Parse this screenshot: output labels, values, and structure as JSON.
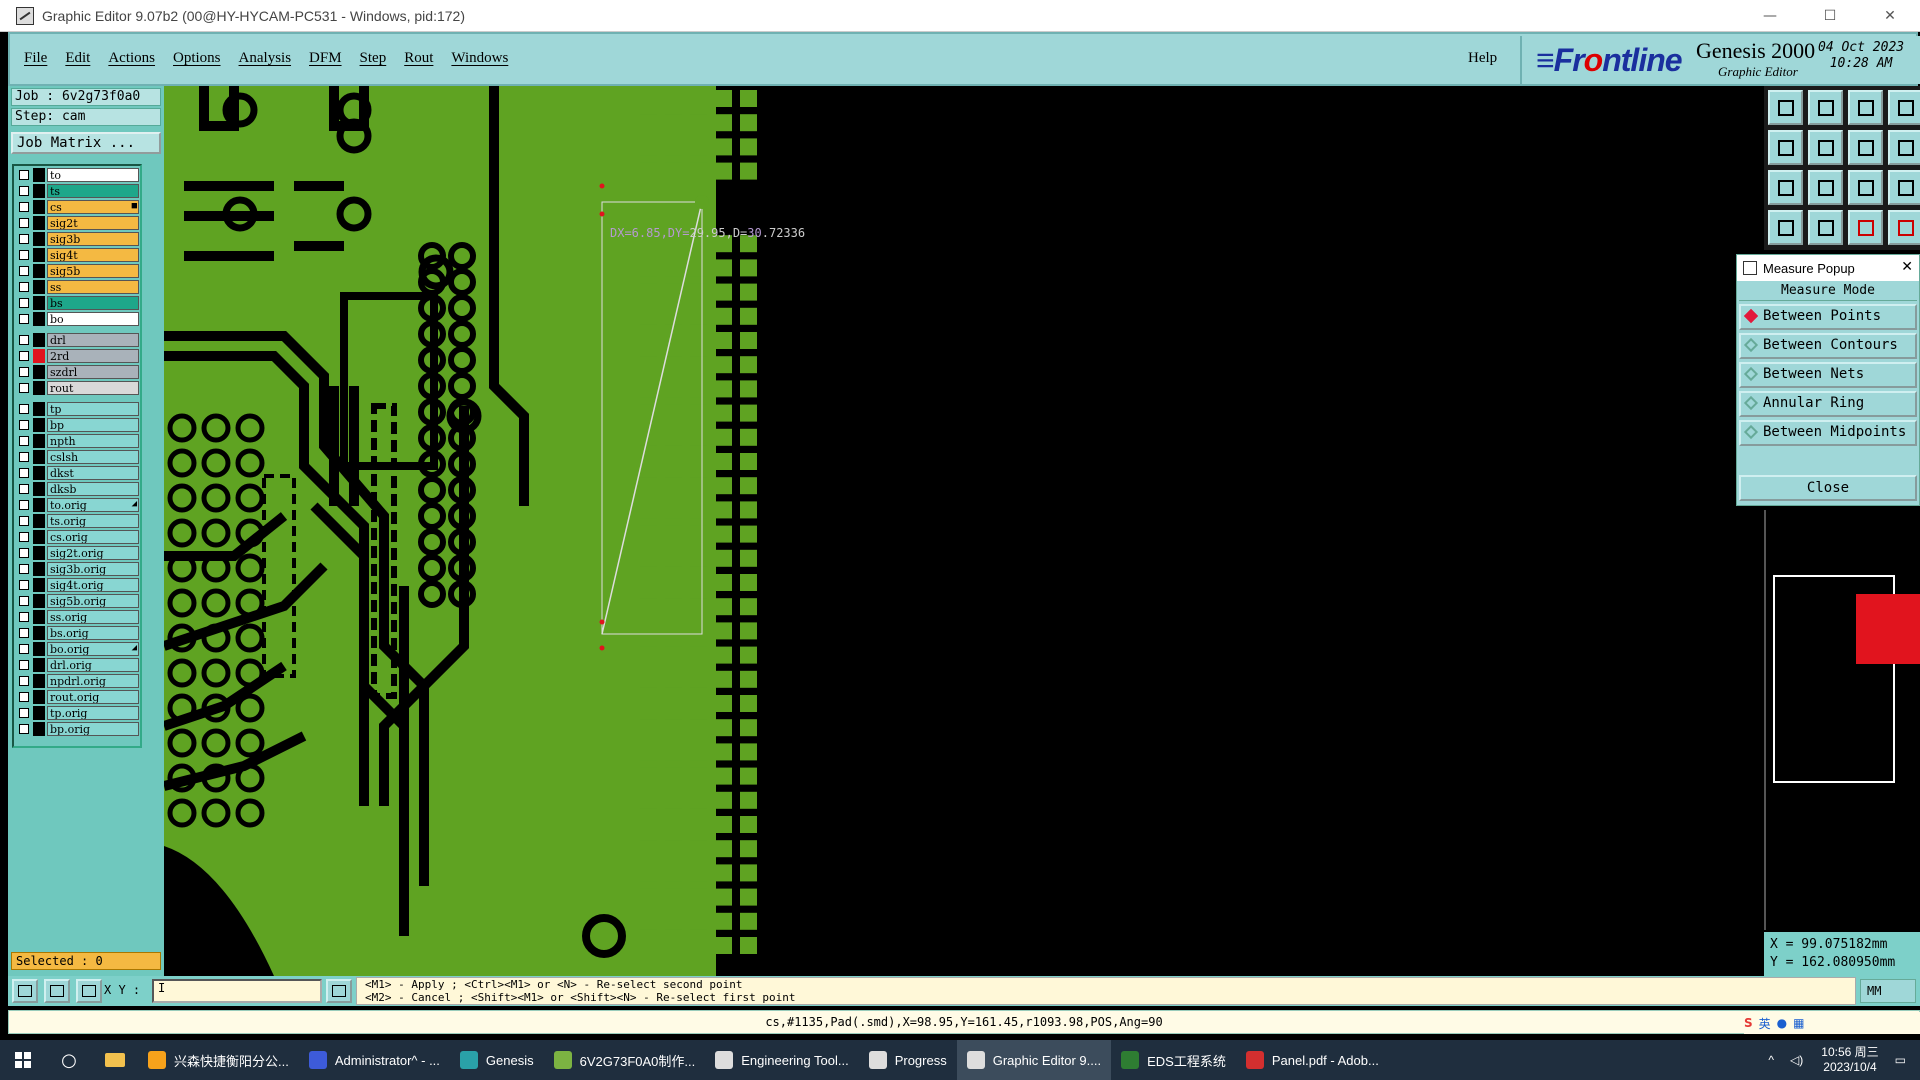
{
  "window": {
    "title": "Graphic Editor 9.07b2 (00@HY-HYCAM-PC531 - Windows, pid:172)",
    "controls": [
      "—",
      "☐",
      "✕"
    ]
  },
  "menu": [
    "File",
    "Edit",
    "Actions",
    "Options",
    "Analysis",
    "DFM",
    "Step",
    "Rout",
    "Windows"
  ],
  "help_label": "Help",
  "brand": {
    "logo_prefix": "≡Fr",
    "logo_o": "o",
    "logo_suffix": "ntline",
    "product": "Genesis 2000",
    "subtitle": "Graphic Editor",
    "date": "04 Oct 2023",
    "time": "10:28 AM"
  },
  "job": {
    "job_line": "Job : 6v2g73f0a0",
    "step_line": "Step: cam",
    "matrix_label": "Job Matrix ..."
  },
  "layers": [
    {
      "name": "to",
      "color": "#ffffff",
      "swatch": "#000000",
      "group": 0
    },
    {
      "name": "ts",
      "color": "#1ea78a",
      "swatch": "#000000",
      "group": 0
    },
    {
      "name": "cs",
      "color": "#f4b942",
      "swatch": "#000000",
      "group": 0,
      "mark": "■"
    },
    {
      "name": "sig2t",
      "color": "#f4b942",
      "swatch": "#000000",
      "group": 0
    },
    {
      "name": "sig3b",
      "color": "#f4b942",
      "swatch": "#000000",
      "group": 0
    },
    {
      "name": "sig4t",
      "color": "#f4b942",
      "swatch": "#000000",
      "group": 0
    },
    {
      "name": "sig5b",
      "color": "#f4b942",
      "swatch": "#000000",
      "group": 0
    },
    {
      "name": "ss",
      "color": "#f4b942",
      "swatch": "#000000",
      "group": 0
    },
    {
      "name": "bs",
      "color": "#1ea78a",
      "swatch": "#000000",
      "group": 0
    },
    {
      "name": "bo",
      "color": "#ffffff",
      "swatch": "#000000",
      "group": 0
    },
    {
      "name": "drl",
      "color": "#a9b2ba",
      "swatch": "#000000",
      "group": 1
    },
    {
      "name": "2rd",
      "color": "#a9b2ba",
      "swatch": "#e1141e",
      "group": 1
    },
    {
      "name": "szdrl",
      "color": "#a9b2ba",
      "swatch": "#000000",
      "group": 1
    },
    {
      "name": "rout",
      "color": "#d9d9d9",
      "swatch": "#000000",
      "group": 1
    },
    {
      "name": "tp",
      "color": "#88d6d2",
      "swatch": "#000000",
      "group": 2
    },
    {
      "name": "bp",
      "color": "#88d6d2",
      "swatch": "#000000",
      "group": 2
    },
    {
      "name": "npth",
      "color": "#88d6d2",
      "swatch": "#000000",
      "group": 2
    },
    {
      "name": "cslsh",
      "color": "#88d6d2",
      "swatch": "#000000",
      "group": 2
    },
    {
      "name": "dkst",
      "color": "#88d6d2",
      "swatch": "#000000",
      "group": 2
    },
    {
      "name": "dksb",
      "color": "#88d6d2",
      "swatch": "#000000",
      "group": 2
    },
    {
      "name": "to.orig",
      "color": "#88d6d2",
      "swatch": "#000000",
      "group": 2,
      "mark": "◢"
    },
    {
      "name": "ts.orig",
      "color": "#88d6d2",
      "swatch": "#000000",
      "group": 2
    },
    {
      "name": "cs.orig",
      "color": "#88d6d2",
      "swatch": "#000000",
      "group": 2
    },
    {
      "name": "sig2t.orig",
      "color": "#88d6d2",
      "swatch": "#000000",
      "group": 2
    },
    {
      "name": "sig3b.orig",
      "color": "#88d6d2",
      "swatch": "#000000",
      "group": 2
    },
    {
      "name": "sig4t.orig",
      "color": "#88d6d2",
      "swatch": "#000000",
      "group": 2
    },
    {
      "name": "sig5b.orig",
      "color": "#88d6d2",
      "swatch": "#000000",
      "group": 2
    },
    {
      "name": "ss.orig",
      "color": "#88d6d2",
      "swatch": "#000000",
      "group": 2
    },
    {
      "name": "bs.orig",
      "color": "#88d6d2",
      "swatch": "#000000",
      "group": 2
    },
    {
      "name": "bo.orig",
      "color": "#88d6d2",
      "swatch": "#000000",
      "group": 2,
      "mark": "◢"
    },
    {
      "name": "drl.orig",
      "color": "#88d6d2",
      "swatch": "#000000",
      "group": 2
    },
    {
      "name": "npdrl.orig",
      "color": "#88d6d2",
      "swatch": "#000000",
      "group": 2
    },
    {
      "name": "rout.orig",
      "color": "#88d6d2",
      "swatch": "#000000",
      "group": 2
    },
    {
      "name": "tp.orig",
      "color": "#88d6d2",
      "swatch": "#000000",
      "group": 2
    },
    {
      "name": "bp.orig",
      "color": "#88d6d2",
      "swatch": "#000000",
      "group": 2
    }
  ],
  "selected_label": "Selected : 0",
  "measure_text": {
    "a": "DX=6.85,DY=",
    "b": "29.95",
    "c": ",D=",
    "d": "30",
    "e": ".72336"
  },
  "measure_popup": {
    "title": "Measure Popup",
    "mode_label": "Measure Mode",
    "options": [
      "Between Points",
      "Between Contours",
      "Between Nets",
      "Annular Ring",
      "Between Midpoints"
    ],
    "selected": "Between Points",
    "close_label": "Close"
  },
  "coords": {
    "x": "X = 99.075182mm",
    "y": "Y = 162.080950mm"
  },
  "xy_label": "X Y :",
  "xy_value": "I",
  "hint": {
    "line1": "<M1> - Apply  ; <Ctrl><M1> or <N> - Re-select second point",
    "line2": "<M2> - Cancel ; <Shift><M1> or <Shift><N> - Re-select first point"
  },
  "unit": "MM",
  "status": "cs,#1135,Pad(.smd),X=98.95,Y=161.45,r1093.98,POS,Ang=90",
  "taskbar": {
    "tasks": [
      {
        "label": "兴森快捷衡阳分公...",
        "icon": "#f7a21b"
      },
      {
        "label": "Administrator^ - ...",
        "icon": "#3d5bd9"
      },
      {
        "label": "Genesis",
        "icon": "#2aa1a8"
      },
      {
        "label": "6V2G73F0A0制作...",
        "icon": "#7cb342"
      },
      {
        "label": "Engineering Tool...",
        "icon": "#dddddd"
      },
      {
        "label": "Progress",
        "icon": "#dddddd"
      },
      {
        "label": "Graphic Editor 9....",
        "icon": "#dddddd"
      },
      {
        "label": "EDS工程系统",
        "icon": "#2e7d32"
      },
      {
        "label": "Panel.pdf - Adob...",
        "icon": "#d32f2f"
      }
    ],
    "active_task": "Graphic Editor 9....",
    "clock_time": "10:56 周三",
    "clock_date": "2023/10/4",
    "ime": "英"
  },
  "colors": {
    "pcb_copper": "#5fa322",
    "background": "#000000",
    "panel": "#9fd7d8",
    "accent_red": "#e1141e"
  }
}
